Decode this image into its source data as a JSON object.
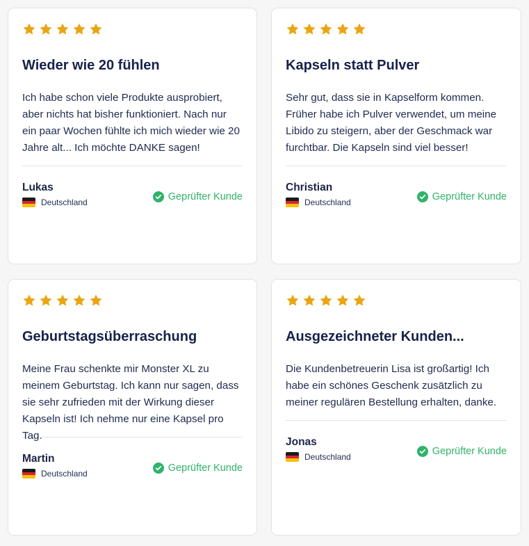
{
  "colors": {
    "star": "#e9a514",
    "verified": "#2fb36a",
    "title": "#16224a"
  },
  "icons": {
    "star": "star-icon",
    "check": "check-circle-icon",
    "flag": "germany-flag-icon"
  },
  "reviews": [
    {
      "rating": 5,
      "title": "Wieder wie 20 fühlen",
      "body": "Ich habe schon viele Produkte ausprobiert, aber nichts hat bisher funktioniert. Nach nur ein paar Wochen fühlte ich mich wieder wie 20 Jahre alt... Ich möchte DANKE sagen!",
      "author": "Lukas",
      "country": "Deutschland",
      "verified": "Geprüfter Kunde"
    },
    {
      "rating": 5,
      "title": "Kapseln statt Pulver",
      "body": "Sehr gut, dass sie in Kapselform kommen. Früher habe ich Pulver verwendet, um meine Libido zu steigern, aber der Geschmack war furchtbar. Die Kapseln sind viel besser!",
      "author": "Christian",
      "country": "Deutschland",
      "verified": "Geprüfter Kunde"
    },
    {
      "rating": 5,
      "title": "Geburtstagsüberraschung",
      "body": "Meine Frau schenkte mir Monster XL zu meinem Geburtstag. Ich kann nur sagen, dass sie sehr zufrieden mit der Wirkung dieser Kapseln ist! Ich nehme nur eine Kapsel pro Tag.",
      "author": "Martin",
      "country": "Deutschland",
      "verified": "Geprüfter Kunde"
    },
    {
      "rating": 5,
      "title": "Ausgezeichneter Kunden...",
      "body": "Die Kundenbetreuerin Lisa ist großartig! Ich habe ein schönes Geschenk zusätzlich zu meiner regulären Bestellung erhalten, danke.",
      "author": "Jonas",
      "country": "Deutschland",
      "verified": "Geprüfter Kunde"
    }
  ]
}
